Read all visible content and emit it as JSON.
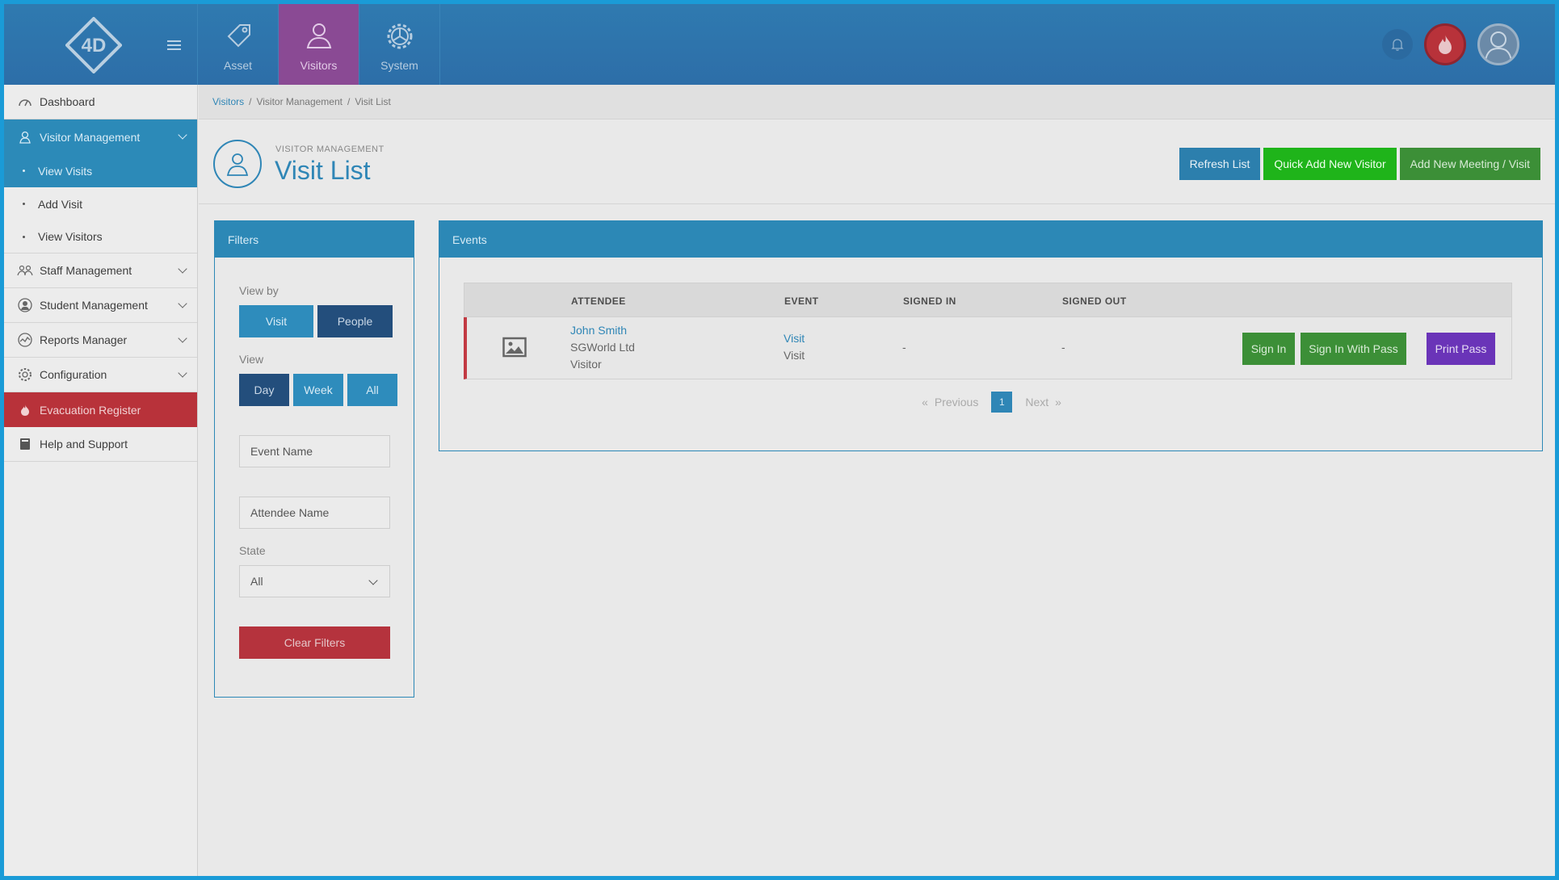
{
  "topnav": {
    "items": [
      {
        "label": "Asset",
        "icon": "tag-icon"
      },
      {
        "label": "Visitors",
        "icon": "person-icon"
      },
      {
        "label": "System",
        "icon": "gear-icon"
      }
    ]
  },
  "sidebar": {
    "items": [
      {
        "label": "Dashboard"
      },
      {
        "label": "Visitor Management"
      },
      {
        "label": "View Visits"
      },
      {
        "label": "Add Visit"
      },
      {
        "label": "View Visitors"
      },
      {
        "label": "Staff Management"
      },
      {
        "label": "Student Management"
      },
      {
        "label": "Reports Manager"
      },
      {
        "label": "Configuration"
      },
      {
        "label": "Evacuation Register"
      },
      {
        "label": "Help and Support"
      }
    ]
  },
  "breadcrumb": [
    "Visitors",
    "Visitor Management",
    "Visit List"
  ],
  "header": {
    "kicker": "VISITOR MANAGEMENT",
    "title": "Visit List",
    "actions": [
      "Refresh List",
      "Quick Add New Visitor",
      "Add New Meeting / Visit"
    ]
  },
  "filters": {
    "title": "Filters",
    "view_by_label": "View by",
    "view_by_options": [
      "Visit",
      "People"
    ],
    "view_by_selected": "People",
    "view_label": "View",
    "view_options": [
      "Day",
      "Week",
      "All"
    ],
    "view_selected": "Day",
    "event_name_placeholder": "Event Name",
    "attendee_name_placeholder": "Attendee Name",
    "state_label": "State",
    "state_value": "All",
    "clear_label": "Clear Filters"
  },
  "events": {
    "title": "Events",
    "columns": [
      "ATTENDEE",
      "EVENT",
      "SIGNED IN",
      "SIGNED OUT"
    ],
    "rows": [
      {
        "attendee_name": "John Smith",
        "attendee_company": "SGWorld Ltd",
        "attendee_type": "Visitor",
        "event_link": "Visit",
        "event_type": "Visit",
        "signed_in": "-",
        "signed_out": "-",
        "actions": [
          "Sign In",
          "Sign In With Pass",
          "Print Pass"
        ]
      }
    ],
    "pager": {
      "prev": "Previous",
      "page": "1",
      "next": "Next",
      "prev_glyph": "«",
      "next_glyph": "»"
    }
  },
  "colors": {
    "primary": "#2c88b6",
    "active_nav": "#8a4a94",
    "danger": "#b8323a",
    "success": "#1fb41a",
    "success_dark": "#3c8f37",
    "purple": "#6a34b8",
    "frame": "#1a9bd7"
  }
}
